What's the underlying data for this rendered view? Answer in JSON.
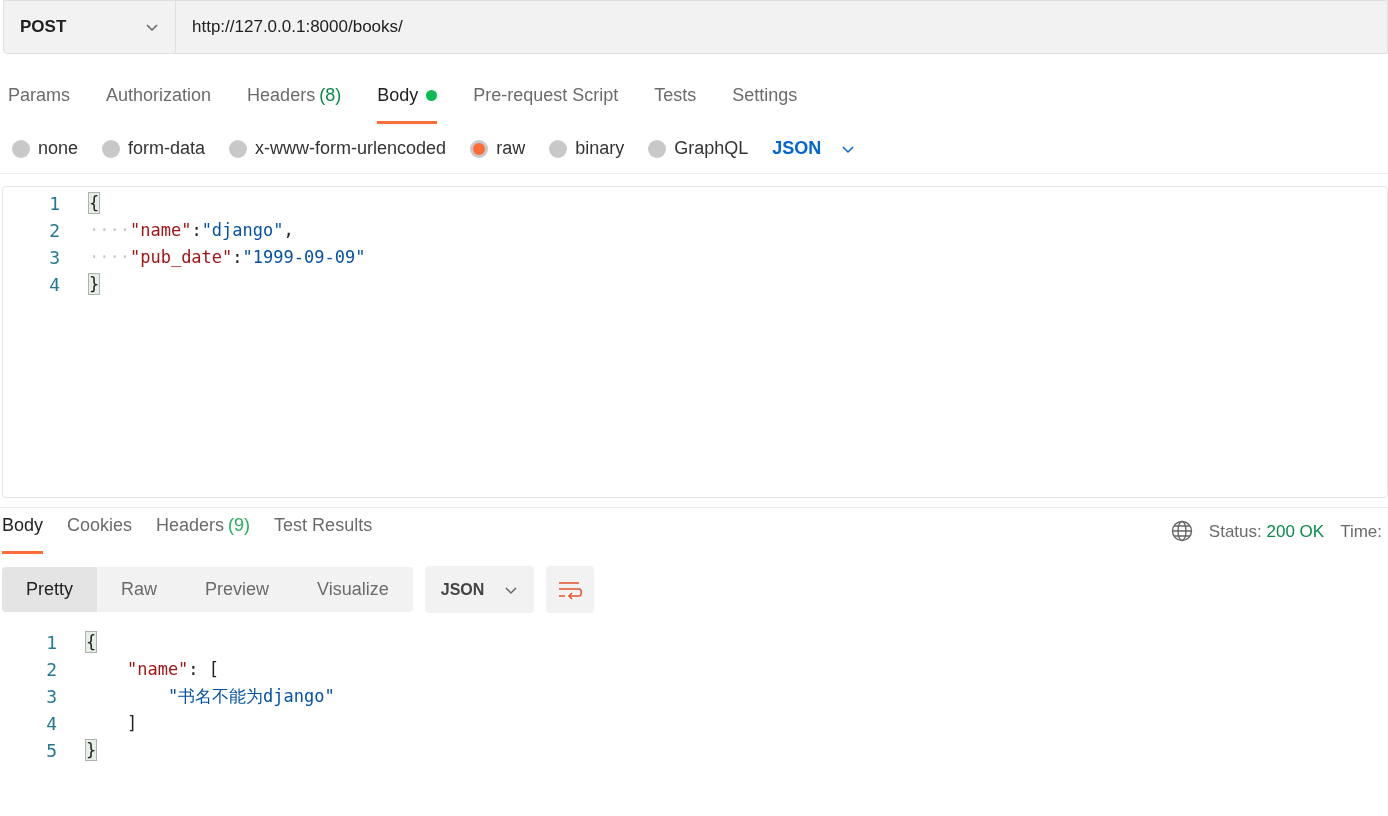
{
  "request": {
    "method": "POST",
    "url": "http://127.0.0.1:8000/books/"
  },
  "request_tabs": [
    {
      "label": "Params",
      "selected": false
    },
    {
      "label": "Authorization",
      "selected": false
    },
    {
      "label": "Headers",
      "count": "(8)",
      "selected": false
    },
    {
      "label": "Body",
      "selected": true,
      "indicator": true
    },
    {
      "label": "Pre-request Script",
      "selected": false
    },
    {
      "label": "Tests",
      "selected": false
    },
    {
      "label": "Settings",
      "selected": false
    }
  ],
  "body_types": [
    {
      "label": "none",
      "selected": false
    },
    {
      "label": "form-data",
      "selected": false
    },
    {
      "label": "x-www-form-urlencoded",
      "selected": false
    },
    {
      "label": "raw",
      "selected": true
    },
    {
      "label": "binary",
      "selected": false
    },
    {
      "label": "GraphQL",
      "selected": false
    }
  ],
  "body_format": "JSON",
  "request_body": [
    {
      "number": "1",
      "tokens": [
        {
          "kind": "bracket",
          "text": "{",
          "highlighted": true
        }
      ]
    },
    {
      "number": "2",
      "tokens": [
        {
          "kind": "indent",
          "text": "····"
        },
        {
          "kind": "key",
          "text": "\"name\""
        },
        {
          "kind": "punct",
          "text": ":"
        },
        {
          "kind": "string",
          "text": "\"django\""
        },
        {
          "kind": "punct",
          "text": ","
        }
      ]
    },
    {
      "number": "3",
      "tokens": [
        {
          "kind": "indent",
          "text": "····"
        },
        {
          "kind": "key",
          "text": "\"pub_date\""
        },
        {
          "kind": "punct",
          "text": ":"
        },
        {
          "kind": "string",
          "text": "\"1999-09-09\""
        }
      ]
    },
    {
      "number": "4",
      "tokens": [
        {
          "kind": "bracket",
          "text": "}",
          "highlighted": true
        }
      ]
    }
  ],
  "response_tabs": [
    {
      "label": "Body",
      "selected": true
    },
    {
      "label": "Cookies",
      "selected": false
    },
    {
      "label": "Headers",
      "count": "(9)",
      "selected": false
    },
    {
      "label": "Test Results",
      "selected": false
    }
  ],
  "status": {
    "label": "Status:",
    "value": "200 OK",
    "time_label": "Time:"
  },
  "view_modes": [
    {
      "label": "Pretty",
      "selected": true
    },
    {
      "label": "Raw",
      "selected": false
    },
    {
      "label": "Preview",
      "selected": false
    },
    {
      "label": "Visualize",
      "selected": false
    }
  ],
  "response_format": "JSON",
  "response_body": [
    {
      "number": "1",
      "tokens": [
        {
          "kind": "bracket",
          "text": "{",
          "highlighted": true
        }
      ]
    },
    {
      "number": "2",
      "tokens": [
        {
          "kind": "key",
          "text": "    \"name\""
        },
        {
          "kind": "punct",
          "text": ": "
        },
        {
          "kind": "punct",
          "text": "["
        }
      ]
    },
    {
      "number": "3",
      "tokens": [
        {
          "kind": "string",
          "text": "        \"书名不能为django\""
        }
      ]
    },
    {
      "number": "4",
      "tokens": [
        {
          "kind": "punct",
          "text": "    ]"
        }
      ]
    },
    {
      "number": "5",
      "tokens": [
        {
          "kind": "bracket",
          "text": "}",
          "highlighted": true
        }
      ]
    }
  ]
}
